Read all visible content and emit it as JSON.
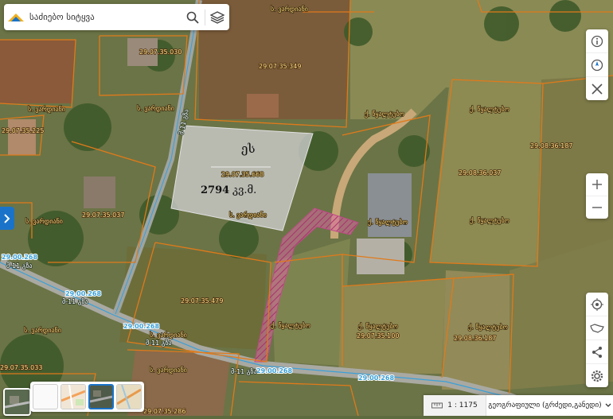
{
  "search": {
    "placeholder": "საძიებო სიტყვა"
  },
  "selected_parcel": {
    "code": "ეს",
    "cadastral": "29.07.35.668",
    "area": "2794",
    "unit": "კვ.მ.",
    "owner": "ს. ვარდიანი"
  },
  "parcels": [
    {
      "code": "29.07.35.349",
      "owner": "ს. ვარდიანი"
    },
    {
      "code": "29.07.35.030",
      "owner": "ს. ვარდიანი"
    },
    {
      "code": "29.07.35.225",
      "owner": "ს. ვარდიანი"
    },
    {
      "code": "29.07.35.037",
      "owner": "ს. ვარდიანი"
    },
    {
      "code": "29.07.35.479",
      "owner": "ს. ვარდიანი"
    },
    {
      "code": "29.08.36.037",
      "owner": "ქ. წყალტუბო"
    },
    {
      "code": "29.08.36.187",
      "owner": "ქ. წყალტუბო"
    },
    {
      "code": "29.08.36.187",
      "owner": "ქ. წყალტუბო"
    },
    {
      "code": "29.07.35.100",
      "owner": "ქ. წყალტუბო"
    },
    {
      "code": "29.07.35.033",
      "owner": "ს. ვარდიანი"
    },
    {
      "code": "29.07.35.286",
      "owner": "ს. ვარდიანი"
    }
  ],
  "road_labels": [
    "მ-11 გზა",
    "მ-11 გზა",
    "მ-11 გზა",
    "მ-11 გზა",
    "მ-11 გზა"
  ],
  "road_numbers": [
    "29.00.268",
    "29.00.268",
    "29.00.268",
    "29.00.268",
    "29.00.268"
  ],
  "scale": {
    "text": "1 : 1175"
  },
  "projection": {
    "label": "გეოგრაფიული (გრძედი,განედი)"
  },
  "colors": {
    "accent": "#1a73c9",
    "parcel_border": "#e07a1a",
    "highlight_parcel": "#c9c9c9",
    "path_hatch": "#d44a8a"
  },
  "toolbar_icons": [
    "info-icon",
    "compass-icon",
    "measure-icon",
    "zoom-in-icon",
    "zoom-out-icon",
    "location-icon",
    "map-georgia-icon",
    "share-icon",
    "settings-icon"
  ]
}
